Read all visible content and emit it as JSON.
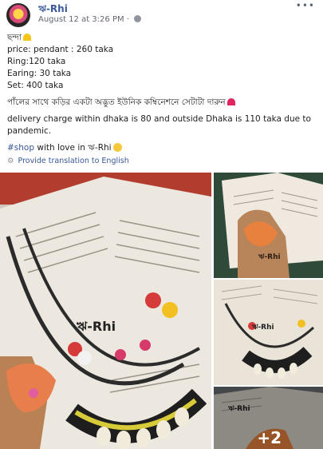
{
  "post": {
    "author": "ঋ-Rhi",
    "timestamp": "August 12 at 3:26 PM",
    "separator": "·",
    "more_icon": "more-dots-icon",
    "privacy_icon": "globe-icon"
  },
  "text": {
    "title": "ছন্দা",
    "price_pendant": "price: pendant : 260 taka",
    "price_ring": "Ring:120 taka",
    "price_earing": "Earing: 30 taka",
    "price_set": "Set: 400 taka",
    "bengali_line": "পাঁলের সাথে কড়ির একটা অদ্ভুত ইউনিক কম্বিনেশনে সেটাটা দারুন",
    "delivery_line1": "delivery charge within dhaka is 80 and outside Dhaka is 110 taka due to",
    "delivery_line2": "pandemic.",
    "hashtag": "#shop",
    "closing": " with love in ঋ-Rhi"
  },
  "translate": {
    "label": "Provide translation to English",
    "icon": "gear-icon"
  },
  "photos": {
    "main_watermark": "ঋ-Rhi",
    "more_count": "+2"
  }
}
